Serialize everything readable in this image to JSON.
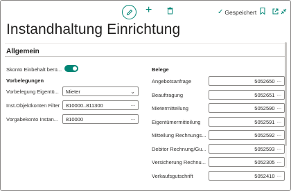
{
  "toolbar": {
    "edit_icon": "pencil-icon",
    "add_icon": "plus-icon",
    "delete_icon": "trash-icon",
    "saved_label": "Gespeichert",
    "bookmark_icon": "bookmark-icon",
    "popout_icon": "popout-icon",
    "collapse_icon": "collapse-icon"
  },
  "page": {
    "title": "Instandhaltung Einrichtung"
  },
  "section": {
    "title": "Allgemein"
  },
  "left": {
    "skonto_label": "Skonto Einbehalt berü...",
    "skonto_value": true,
    "group_title": "Vorbelegungen",
    "fields": [
      {
        "label": "Vorbelegung Eigentü...",
        "value": "Mieter",
        "kind": "select"
      },
      {
        "label": "Inst.Objektkonten Filter",
        "value": "810000..811300",
        "kind": "lookup"
      },
      {
        "label": "Vorgabekonto Instan...",
        "value": "810000",
        "kind": "lookup"
      }
    ]
  },
  "right": {
    "group_title": "Belege",
    "fields": [
      {
        "label": "Angebotsanfrage",
        "value": "5052650"
      },
      {
        "label": "Beauftragung",
        "value": "5052651"
      },
      {
        "label": "Mietermitteilung",
        "value": "5052590"
      },
      {
        "label": "Eigentümermitteilung",
        "value": "5052591"
      },
      {
        "label": "Mitteilung Rechnungs...",
        "value": "5052592"
      },
      {
        "label": "Debitor Rechnung/Gu...",
        "value": "5052593"
      },
      {
        "label": "Versicherung Rechnu...",
        "value": "5052305"
      },
      {
        "label": "Verkaufsgutschrift",
        "value": "5052410"
      }
    ]
  },
  "colors": {
    "accent": "#008575"
  }
}
